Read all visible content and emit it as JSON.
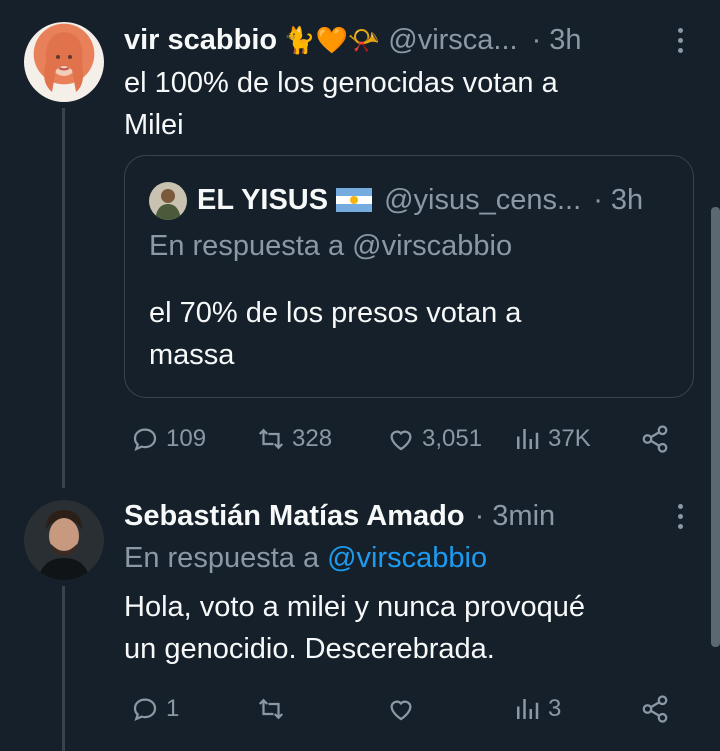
{
  "tweet1": {
    "name": "vir scabbio",
    "emoji": "🐈🧡📯",
    "handle": "@virsca...",
    "time": "· 3h",
    "text_line1": "el 100% de los genocidas votan a",
    "text_line2": "Milei"
  },
  "quote": {
    "name": "EL YISUS",
    "handle": "@yisus_cens...",
    "time": "· 3h",
    "reply_to": "En respuesta a @virscabbio",
    "text_line1": "el 70% de los presos votan a",
    "text_line2": "massa"
  },
  "tweet1_actions": {
    "replies": "109",
    "retweets": "328",
    "likes": "3,051",
    "views": "37K"
  },
  "tweet2": {
    "name": "Sebastián Matías Amado",
    "time": "· 3min",
    "reply_prefix": "En respuesta a",
    "reply_handle": "@virscabbio",
    "text_line1": "Hola, voto a milei y nunca provoqué",
    "text_line2": "un genocidio. Descerebrada."
  },
  "tweet2_actions": {
    "replies": "1",
    "retweets": "",
    "likes": "",
    "views": "3"
  },
  "colors": {
    "background": "#15202b",
    "text": "#f7f9f9",
    "muted": "#8b98a5",
    "link": "#1d9bf0",
    "border": "#38444d"
  }
}
